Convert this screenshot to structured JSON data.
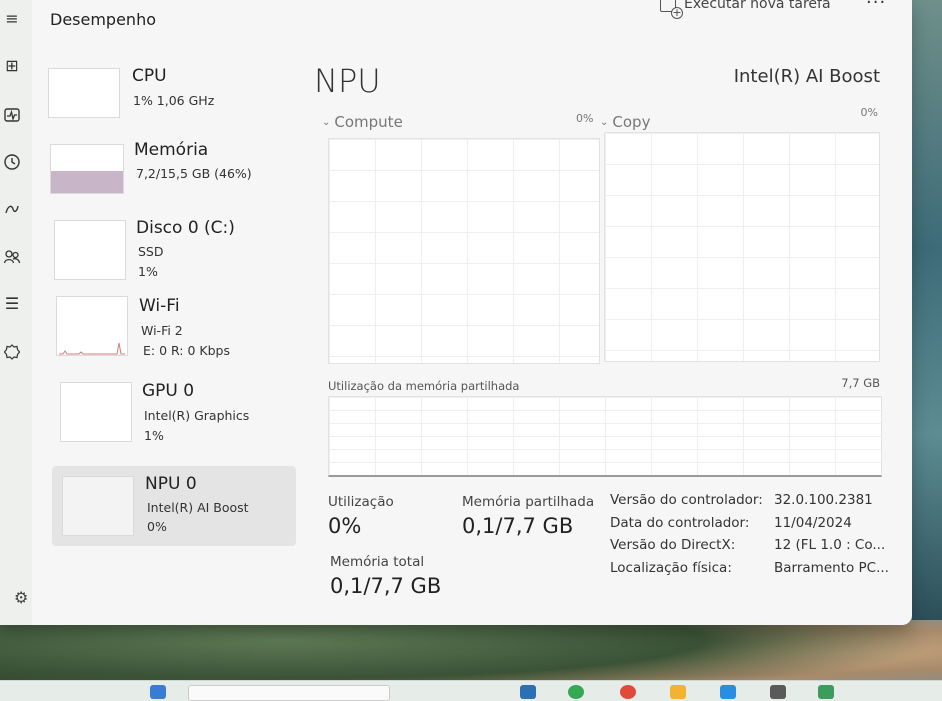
{
  "header": {
    "title": "Desempenho",
    "run_task": "Executar nova tarefa",
    "more": "···"
  },
  "icons": {
    "menu": "hamburger-icon",
    "processes": "processes-icon",
    "performance": "performance-icon",
    "history": "history-icon",
    "startup": "startup-icon",
    "users": "users-icon",
    "details": "details-icon",
    "services": "services-icon",
    "settings": "gear-icon"
  },
  "devices": [
    {
      "name": "CPU",
      "line1": "1% 1,06 GHz",
      "line2": ""
    },
    {
      "name": "Memória",
      "line1": "7,2/15,5 GB (46%)",
      "line2": ""
    },
    {
      "name": "Disco 0 (C:)",
      "line1": "SSD",
      "line2": "1%"
    },
    {
      "name": "Wi-Fi",
      "line1": "Wi-Fi 2",
      "line2": "E: 0 R: 0 Kbps"
    },
    {
      "name": "GPU 0",
      "line1": "Intel(R) Graphics",
      "line2": "1%"
    },
    {
      "name": "NPU 0",
      "line1": "Intel(R) AI Boost",
      "line2": "0%"
    }
  ],
  "main": {
    "title": "NPU",
    "model": "Intel(R) AI Boost",
    "graph_compute_label": "Compute",
    "graph_compute_pct": "0%",
    "graph_copy_label": "Copy",
    "graph_copy_pct": "0%",
    "memory_graph_label": "Utilização da memória partilhada",
    "memory_graph_max": "7,7 GB"
  },
  "stats": {
    "utilization_label": "Utilização",
    "utilization_value": "0%",
    "shared_mem_label": "Memória partilhada",
    "shared_mem_value": "0,1/7,7 GB",
    "total_mem_label": "Memória total",
    "total_mem_value": "0,1/7,7 GB"
  },
  "properties": [
    {
      "key": "Versão do controlador:",
      "value": "32.0.100.2381"
    },
    {
      "key": "Data do controlador:",
      "value": "11/04/2024"
    },
    {
      "key": "Versão do DirectX:",
      "value": "12 (FL 1.0 : Co..."
    },
    {
      "key": "Localização física:",
      "value": "Barramento PC..."
    }
  ],
  "colors": {
    "memory_fill": "#c9b5c8",
    "wifi_spike": "#d77a7a"
  }
}
